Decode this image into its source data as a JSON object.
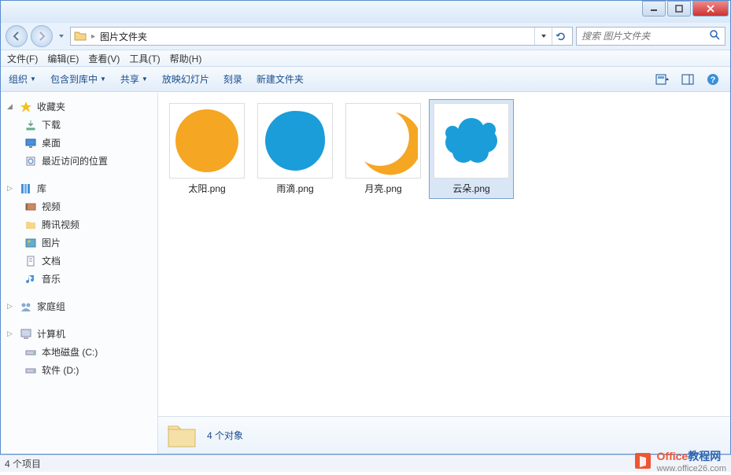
{
  "titlebar": {},
  "nav": {
    "breadcrumb": "图片文件夹",
    "search_placeholder": "搜索 图片文件夹"
  },
  "menubar": {
    "file": "文件(F)",
    "edit": "编辑(E)",
    "view": "查看(V)",
    "tools": "工具(T)",
    "help": "帮助(H)"
  },
  "toolbar": {
    "organize": "组织",
    "include": "包含到库中",
    "share": "共享",
    "slideshow": "放映幻灯片",
    "burn": "刻录",
    "newfolder": "新建文件夹"
  },
  "sidebar": {
    "favorites": {
      "label": "收藏夹",
      "items": [
        {
          "label": "下载",
          "icon": "download"
        },
        {
          "label": "桌面",
          "icon": "desktop"
        },
        {
          "label": "最近访问的位置",
          "icon": "recent"
        }
      ]
    },
    "libraries": {
      "label": "库",
      "items": [
        {
          "label": "视频",
          "icon": "video"
        },
        {
          "label": "腾讯视频",
          "icon": "folder"
        },
        {
          "label": "图片",
          "icon": "pictures"
        },
        {
          "label": "文档",
          "icon": "docs"
        },
        {
          "label": "音乐",
          "icon": "music"
        }
      ]
    },
    "homegroup": {
      "label": "家庭组"
    },
    "computer": {
      "label": "计算机",
      "items": [
        {
          "label": "本地磁盘 (C:)",
          "icon": "drive"
        },
        {
          "label": "软件 (D:)",
          "icon": "drive"
        }
      ]
    }
  },
  "files": [
    {
      "name": "太阳.png",
      "shape": "sun",
      "selected": false
    },
    {
      "name": "雨滴.png",
      "shape": "raindrop",
      "selected": false
    },
    {
      "name": "月亮.png",
      "shape": "moon",
      "selected": false
    },
    {
      "name": "云朵.png",
      "shape": "cloud",
      "selected": true
    }
  ],
  "details": {
    "summary": "4 个对象"
  },
  "statusbar": {
    "text": "4 个项目"
  },
  "watermark": {
    "brand1": "Office",
    "brand2": "教程网",
    "url": "www.office26.com"
  },
  "colors": {
    "orange": "#f5a623",
    "blue": "#1b9dd9"
  }
}
